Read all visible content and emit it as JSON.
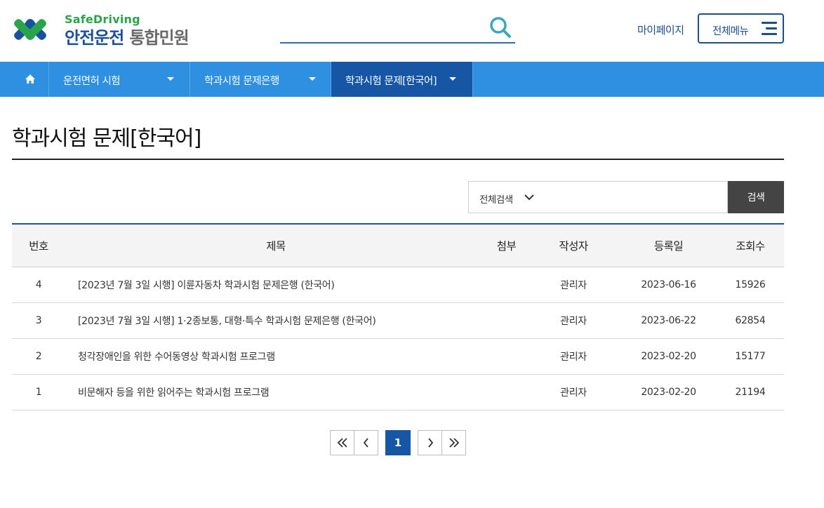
{
  "header": {
    "logo_top": "SafeDriving",
    "logo_main": "안전운전",
    "logo_sub": "통합민원",
    "search_placeholder": "",
    "mypage_label": "마이페이지",
    "allmenu_label": "전체메뉴"
  },
  "nav": {
    "home_icon": "home-icon",
    "items": [
      {
        "label": "운전면허 시험"
      },
      {
        "label": "학과시험 문제은행"
      },
      {
        "label": "학과시험 문제[한국어]"
      }
    ],
    "active_color": "#1656a5",
    "bar_color": "#2f8fe0"
  },
  "page": {
    "title": "학과시험 문제[한국어]"
  },
  "search": {
    "select_label": "전체검색",
    "keyword_value": "",
    "button_label": "검색"
  },
  "table": {
    "headers": [
      "번호",
      "제목",
      "첨부",
      "작성자",
      "등록일",
      "조회수"
    ],
    "rows": [
      {
        "no": "4",
        "title": "[2023년 7월 3일 시행] 이륜자동차 학과시험 문제은행 (한국어)",
        "attach": "",
        "author": "관리자",
        "date": "2023-06-16",
        "views": "15926"
      },
      {
        "no": "3",
        "title": "[2023년 7월 3일 시행] 1·2종보통, 대형·특수 학과시험 문제은행 (한국어)",
        "attach": "",
        "author": "관리자",
        "date": "2023-06-22",
        "views": "62854"
      },
      {
        "no": "2",
        "title": "청각장애인을 위한 수어동영상 학과시험 프로그램",
        "attach": "",
        "author": "관리자",
        "date": "2023-02-20",
        "views": "15177"
      },
      {
        "no": "1",
        "title": "비문해자 등을 위한 읽어주는 학과시험 프로그램",
        "attach": "",
        "author": "관리자",
        "date": "2023-02-20",
        "views": "21194"
      }
    ]
  },
  "pagination": {
    "current": "1"
  }
}
